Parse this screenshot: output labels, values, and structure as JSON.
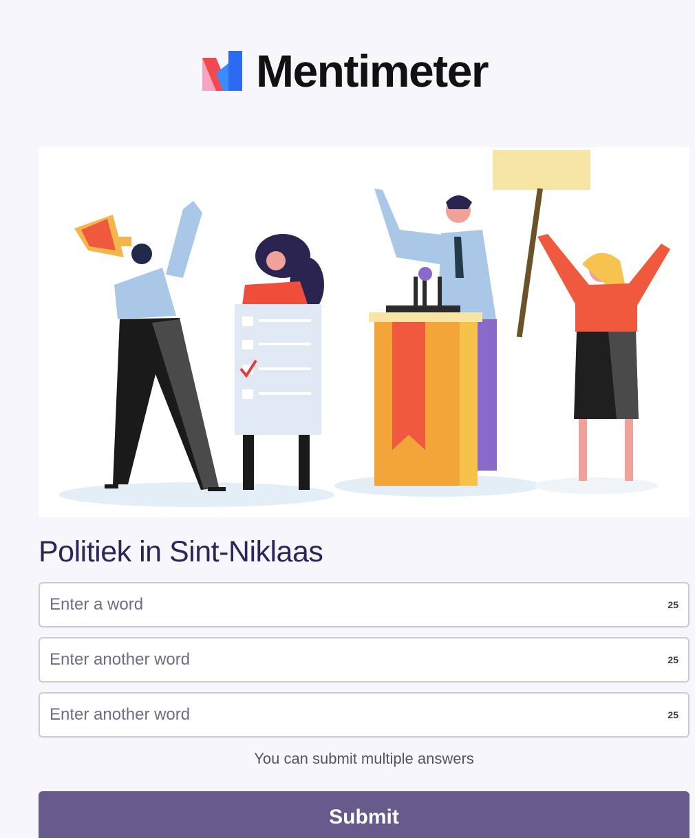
{
  "brand": {
    "name": "Mentimeter",
    "colors": {
      "pink": "#f4a6c0",
      "red": "#f04a4f",
      "blue": "#2c6bf0"
    }
  },
  "question": {
    "title": "Politiek in Sint-Niklaas"
  },
  "inputs": [
    {
      "placeholder": "Enter a word",
      "value": "",
      "char_limit": "25"
    },
    {
      "placeholder": "Enter another word",
      "value": "",
      "char_limit": "25"
    },
    {
      "placeholder": "Enter another word",
      "value": "",
      "char_limit": "25"
    }
  ],
  "hint": "You can submit multiple answers",
  "submit_label": "Submit",
  "theme": {
    "button": "#665b8a",
    "title": "#2b2659",
    "background": "#f7f6fb"
  }
}
